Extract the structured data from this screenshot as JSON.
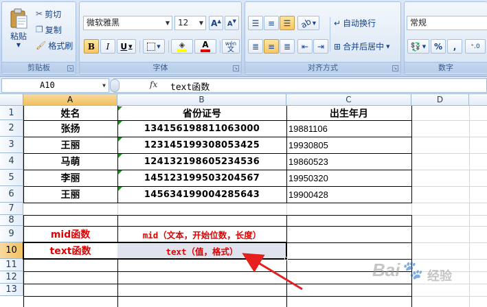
{
  "ribbon": {
    "clipboard": {
      "paste_label": "粘贴",
      "cut_label": "剪切",
      "copy_label": "复制",
      "format_painter_label": "格式刷",
      "group_label": "剪贴板"
    },
    "font": {
      "font_name": "微软雅黑",
      "font_size": "12",
      "bold_label": "B",
      "italic_label": "I",
      "underline_label": "U",
      "phonetic_label": "wén",
      "group_label": "字体",
      "font_color": "#e00000",
      "fill_color": "#ffff00"
    },
    "alignment": {
      "wrap_text_label": "自动换行",
      "merge_center_label": "合并后居中",
      "group_label": "对齐方式"
    },
    "number": {
      "format_value": "常规",
      "percent_label": "%",
      "comma_label": ",",
      "group_label": "数字"
    }
  },
  "formula_bar": {
    "name_box": "A10",
    "fx_label": "fx",
    "formula": "text函数"
  },
  "sheet": {
    "columns": [
      "A",
      "B",
      "C",
      "D"
    ],
    "selected_column": "A",
    "rows": [
      "1",
      "2",
      "3",
      "4",
      "5",
      "6",
      "7",
      "8",
      "9",
      "10",
      "11",
      "12",
      "13"
    ],
    "selected_row": "10",
    "headers": {
      "name": "姓名",
      "id": "省份证号",
      "birth": "出生年月"
    },
    "records": [
      {
        "name": "张扬",
        "id": "134156198811063000",
        "birth": "19881106"
      },
      {
        "name": "王丽",
        "id": "123145199308053425",
        "birth": "19930805"
      },
      {
        "name": "马萌",
        "id": "124132198605234536",
        "birth": "19860523"
      },
      {
        "name": "李丽",
        "id": "145123199503204567",
        "birth": "19950320"
      },
      {
        "name": "王丽",
        "id": "145634199004285643",
        "birth": "19900428"
      }
    ],
    "row9": {
      "a": "mid函数",
      "b": "mid（文本，开始位数，长度）"
    },
    "row10": {
      "a": "text函数",
      "b": "text（值，格式）"
    }
  },
  "watermark": "Bai",
  "watermark_suffix": "经验",
  "colors": {
    "annotation_red": "#e00000",
    "selection_orange": "#f1c15f"
  }
}
